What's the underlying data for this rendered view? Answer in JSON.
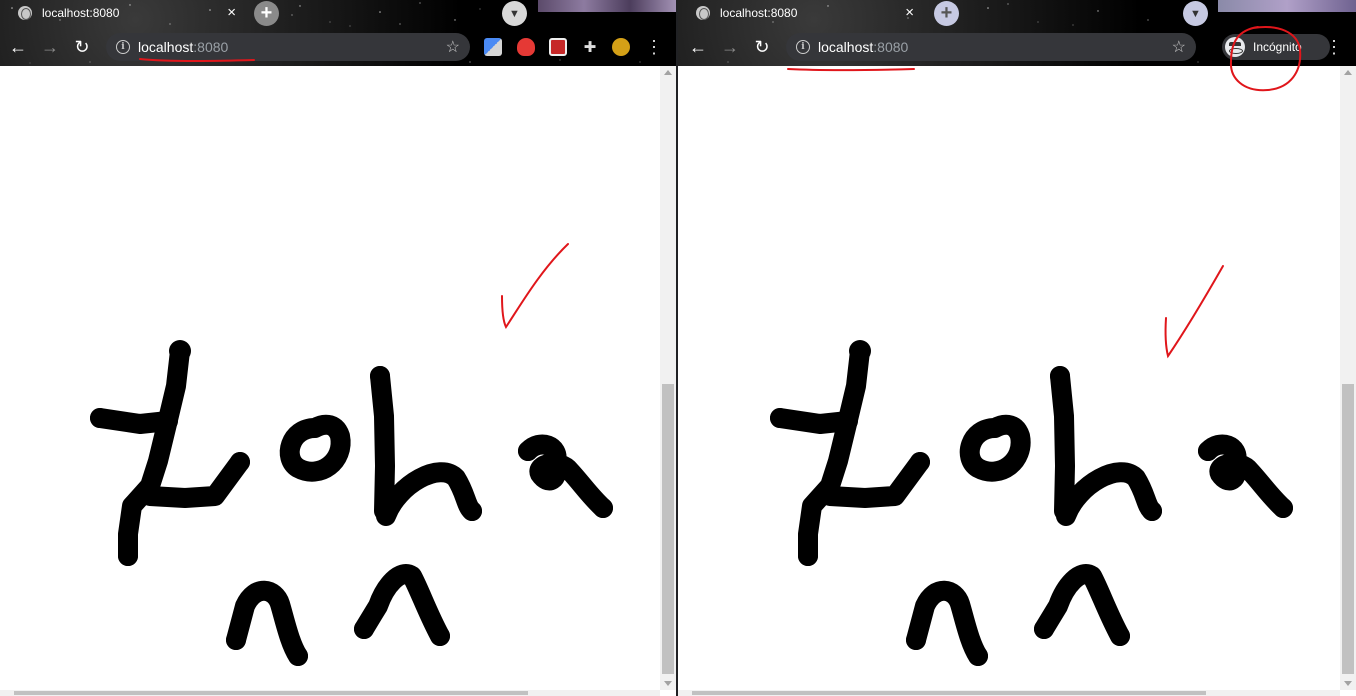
{
  "left_window": {
    "tab_title": "localhost:8080",
    "url_host": "localhost",
    "url_port": ":8080"
  },
  "right_window": {
    "tab_title": "localhost:8080",
    "url_host": "localhost",
    "url_port": ":8080",
    "incognito_label": "Incógnito"
  },
  "icons": {
    "close": "×",
    "new_tab": "+",
    "back": "←",
    "forward": "→",
    "reload": "↻",
    "info": "i",
    "star": "☆",
    "menu": "⋮",
    "tab_search": "▼"
  },
  "extensions": [
    "translate-extension-icon",
    "ublock-extension-icon",
    "red-extension-icon",
    "extensions-puzzle-icon",
    "profile-avatar-icon"
  ],
  "colors": {
    "annotation_red": "#e0161b",
    "ink": "#000000"
  }
}
